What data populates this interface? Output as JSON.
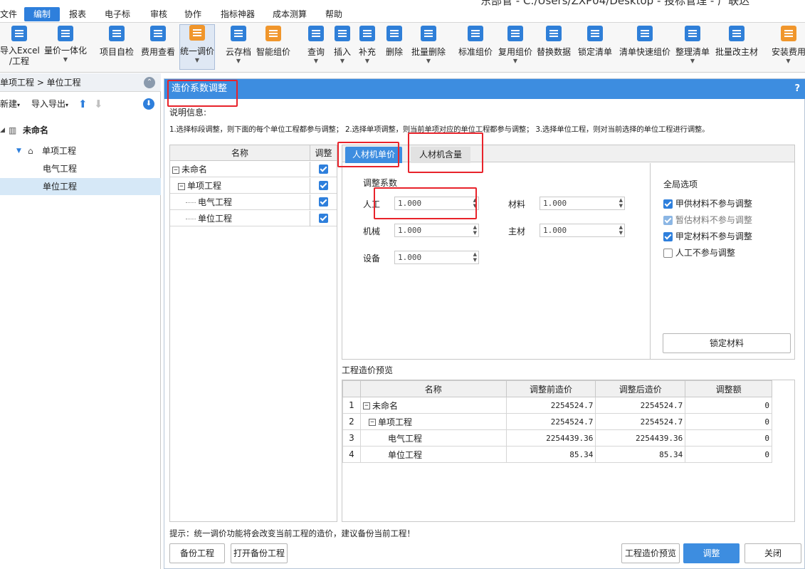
{
  "window": {
    "title_fragment": "东部管 - C:/Users/ZXP04/Desktop - 投标管理 - 广联达"
  },
  "menu": {
    "items": [
      "文件",
      "编制",
      "报表",
      "电子标",
      "审核",
      "协作",
      "指标神器",
      "成本测算",
      "帮助"
    ],
    "active": "编制"
  },
  "ribbon": {
    "buttons": [
      {
        "label": "导入Excel",
        "label2": "/工程",
        "icon": "import-excel-icon"
      },
      {
        "label": "量价一体化",
        "icon": "qty-price-icon"
      },
      {
        "label": "项目自检",
        "icon": "self-check-icon"
      },
      {
        "label": "费用查看",
        "icon": "fee-view-icon"
      },
      {
        "label": "统一调价",
        "icon": "unified-adjust-icon"
      },
      {
        "label": "云存档",
        "icon": "cloud-save-icon"
      },
      {
        "label": "智能组价",
        "icon": "smart-price-icon"
      },
      {
        "label": "查询",
        "icon": "query-icon"
      },
      {
        "label": "插入",
        "icon": "insert-icon"
      },
      {
        "label": "补充",
        "icon": "supplement-icon"
      },
      {
        "label": "删除",
        "icon": "delete-icon"
      },
      {
        "label": "批量删除",
        "icon": "batch-delete-icon"
      },
      {
        "label": "标准组价",
        "icon": "standard-price-icon"
      },
      {
        "label": "复用组价",
        "icon": "reuse-price-icon"
      },
      {
        "label": "替换数据",
        "icon": "replace-data-icon"
      },
      {
        "label": "锁定清单",
        "icon": "lock-list-icon"
      },
      {
        "label": "清单快速组价",
        "icon": "quick-price-icon"
      },
      {
        "label": "整理清单",
        "icon": "organize-list-icon"
      },
      {
        "label": "批量改主材",
        "icon": "batch-material-icon"
      },
      {
        "label": "安装费用",
        "icon": "install-fee-icon"
      }
    ]
  },
  "left": {
    "breadcrumb": "单项工程 > 单位工程",
    "new_label": "新建",
    "import_export_label": "导入导出",
    "tree": [
      {
        "label": "未命名",
        "level": 0
      },
      {
        "label": "单项工程",
        "level": 1
      },
      {
        "label": "电气工程",
        "level": 2
      },
      {
        "label": "单位工程",
        "level": 2
      }
    ]
  },
  "dialog": {
    "title": "造价系数调整",
    "help": "?",
    "info_label": "说明信息:",
    "info_text": "1.选择标段调整，则下面的每个单位工程都参与调整；  2.选择单项调整，则当前单项对应的单位工程都参与调整；  3.选择单位工程，则对当前选择的单位工程进行调整。",
    "tree_headers": {
      "name": "名称",
      "adjust": "调整"
    },
    "tree_rows": [
      {
        "label": "未命名",
        "checked": true
      },
      {
        "label": "单项工程",
        "checked": true
      },
      {
        "label": "电气工程",
        "checked": true
      },
      {
        "label": "单位工程",
        "checked": true
      }
    ],
    "tabs": [
      "人材机单价",
      "人材机含量"
    ],
    "active_tab": "人材机单价",
    "coef_title": "调整系数",
    "coef": {
      "labor": {
        "label": "人工",
        "value": "1.000"
      },
      "material": {
        "label": "材料",
        "value": "1.000"
      },
      "machine": {
        "label": "机械",
        "value": "1.000"
      },
      "main_material": {
        "label": "主材",
        "value": "1.000"
      },
      "equipment": {
        "label": "设备",
        "value": "1.000"
      }
    },
    "global": {
      "title": "全局选项",
      "options": [
        {
          "label": "甲供材料不参与调整",
          "state": "on"
        },
        {
          "label": "暂估材料不参与调整",
          "state": "disabled"
        },
        {
          "label": "甲定材料不参与调整",
          "state": "on"
        },
        {
          "label": "人工不参与调整",
          "state": "off"
        }
      ],
      "lock_button": "锁定材料"
    },
    "preview": {
      "title": "工程造价预览",
      "headers": [
        "",
        "名称",
        "调整前造价",
        "调整后造价",
        "调整额"
      ],
      "rows": [
        {
          "no": "1",
          "name": "未命名",
          "before": "2254524.7",
          "after": "2254524.7",
          "diff": "0",
          "level": 0
        },
        {
          "no": "2",
          "name": "单项工程",
          "before": "2254524.7",
          "after": "2254524.7",
          "diff": "0",
          "level": 1
        },
        {
          "no": "3",
          "name": "电气工程",
          "before": "2254439.36",
          "after": "2254439.36",
          "diff": "0",
          "level": 2
        },
        {
          "no": "4",
          "name": "单位工程",
          "before": "85.34",
          "after": "85.34",
          "diff": "0",
          "level": 2
        }
      ]
    },
    "tip": "提示：统一调价功能将会改变当前工程的造价，建议备份当前工程！",
    "buttons": {
      "backup": "备份工程",
      "open_backup": "打开备份工程",
      "preview": "工程造价预览",
      "adjust": "调整",
      "close": "关闭"
    }
  },
  "colors": {
    "accent": "#3d8de0",
    "highlight": "#e8232b"
  }
}
